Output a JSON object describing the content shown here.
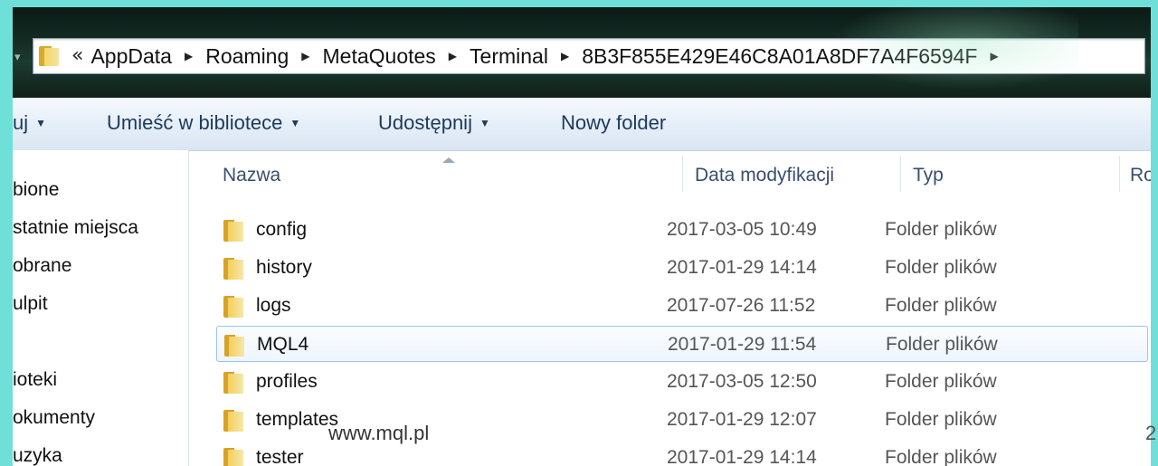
{
  "address": {
    "chevron": "«",
    "segments": [
      "AppData",
      "Roaming",
      "MetaQuotes",
      "Terminal",
      "8B3F855E429E46C8A01A8DF7A4F6594F"
    ]
  },
  "toolbar": {
    "organize_label": "uj",
    "library_label": "Umieść w bibliotece",
    "share_label": "Udostępnij",
    "newfolder_label": "Nowy folder"
  },
  "nav": {
    "items": [
      "bione",
      "statnie miejsca",
      "obrane",
      "ulpit",
      "ioteki",
      "okumenty",
      "uzyka"
    ]
  },
  "columns": {
    "name": "Nazwa",
    "date": "Data modyfikacji",
    "type": "Typ",
    "size": "Ro"
  },
  "files": [
    {
      "name": "config",
      "date": "2017-03-05 10:49",
      "type": "Folder plików"
    },
    {
      "name": "history",
      "date": "2017-01-29 14:14",
      "type": "Folder plików"
    },
    {
      "name": "logs",
      "date": "2017-07-26 11:52",
      "type": "Folder plików"
    },
    {
      "name": "MQL4",
      "date": "2017-01-29 11:54",
      "type": "Folder plików"
    },
    {
      "name": "profiles",
      "date": "2017-03-05 12:50",
      "type": "Folder plików"
    },
    {
      "name": "templates",
      "date": "2017-01-29 12:07",
      "type": "Folder plików"
    },
    {
      "name": "tester",
      "date": "2017-01-29 14:14",
      "type": "Folder plików"
    }
  ],
  "watermark": "www.mql.pl",
  "page_number": "2",
  "icons": {
    "back": "back-arrow-icon",
    "folder": "folder-icon",
    "separator": "breadcrumb-arrow-icon",
    "dropdown": "chevron-down-icon"
  }
}
